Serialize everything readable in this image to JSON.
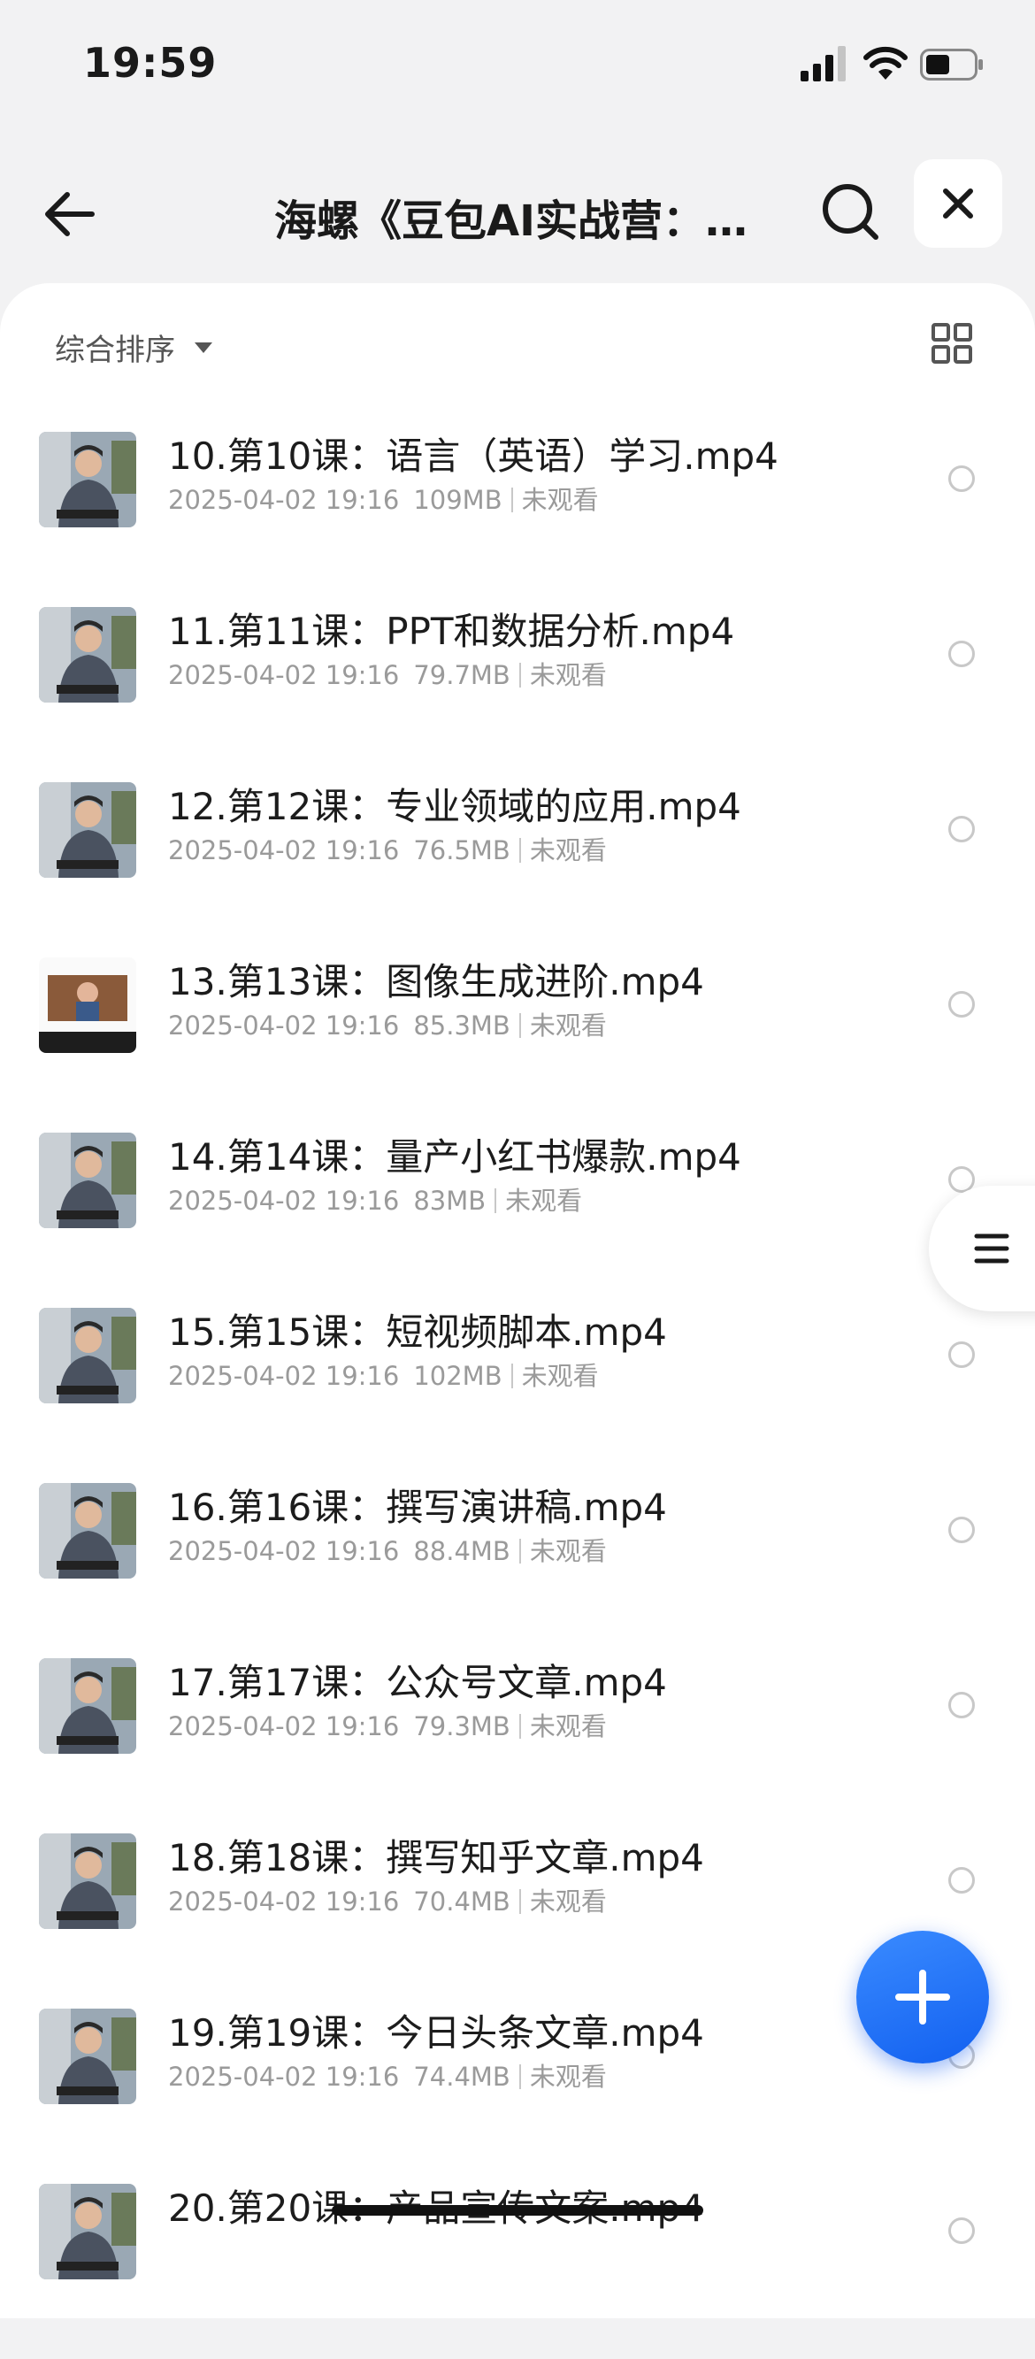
{
  "status_bar": {
    "time": "19:59"
  },
  "header": {
    "title": "海螺《豆包AI实战营：..."
  },
  "toolbar": {
    "sort_label": "综合排序"
  },
  "files": [
    {
      "name": "10.第10课：语言（英语）学习.mp4",
      "date": "2025-04-02 19:16",
      "size": "109MB",
      "status": "未观看"
    },
    {
      "name": "11.第11课：PPT和数据分析.mp4",
      "date": "2025-04-02 19:16",
      "size": "79.7MB",
      "status": "未观看"
    },
    {
      "name": "12.第12课：专业领域的应用.mp4",
      "date": "2025-04-02 19:16",
      "size": "76.5MB",
      "status": "未观看"
    },
    {
      "name": "13.第13课：图像生成进阶.mp4",
      "date": "2025-04-02 19:16",
      "size": "85.3MB",
      "status": "未观看"
    },
    {
      "name": "14.第14课：量产小红书爆款.mp4",
      "date": "2025-04-02 19:16",
      "size": "83MB",
      "status": "未观看"
    },
    {
      "name": "15.第15课：短视频脚本.mp4",
      "date": "2025-04-02 19:16",
      "size": "102MB",
      "status": "未观看"
    },
    {
      "name": "16.第16课：撰写演讲稿.mp4",
      "date": "2025-04-02 19:16",
      "size": "88.4MB",
      "status": "未观看"
    },
    {
      "name": "17.第17课：公众号文章.mp4",
      "date": "2025-04-02 19:16",
      "size": "79.3MB",
      "status": "未观看"
    },
    {
      "name": "18.第18课：撰写知乎文章.mp4",
      "date": "2025-04-02 19:16",
      "size": "70.4MB",
      "status": "未观看"
    },
    {
      "name": "19.第19课：今日头条文章.mp4",
      "date": "2025-04-02 19:16",
      "size": "74.4MB",
      "status": "未观看"
    },
    {
      "name": "20.第20课：产品宣传文案.mp4",
      "date": "",
      "size": "",
      "status": ""
    }
  ],
  "colors": {
    "accent": "#1a6ff5",
    "meta_text": "#9a9a9a",
    "background": "#f2f2f3"
  }
}
